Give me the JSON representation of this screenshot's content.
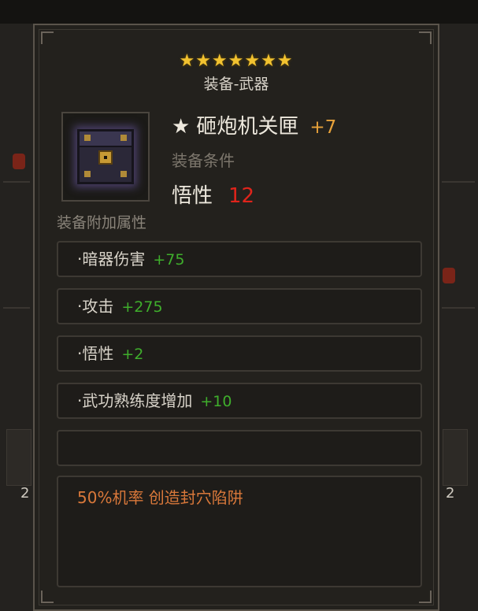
{
  "tooltip": {
    "stars": "★★★★★★★",
    "star_count": 7,
    "category": "装备-武器",
    "item": {
      "star_mark": "★",
      "name": "砸炮机关匣",
      "enhance": "+7",
      "icon": "mechanism-chest-icon"
    },
    "requirement": {
      "label": "装备条件",
      "stat_name": "悟性",
      "stat_value": "12"
    },
    "attributes_header": "装备附加属性",
    "attributes": [
      {
        "name": "·暗器伤害",
        "bonus": "+75"
      },
      {
        "name": "·攻击",
        "bonus": "+275"
      },
      {
        "name": "·悟性",
        "bonus": "+2"
      },
      {
        "name": "·武功熟练度增加",
        "bonus": "+10"
      }
    ],
    "special_effect": "50%机率 创造封穴陷阱"
  },
  "background": {
    "left_count": "2",
    "right_count": "2"
  },
  "colors": {
    "star": "#f2c230",
    "enhance": "#e8a23a",
    "requirement_value": "#e0241b",
    "bonus": "#3fae2c",
    "effect": "#d9783a"
  }
}
